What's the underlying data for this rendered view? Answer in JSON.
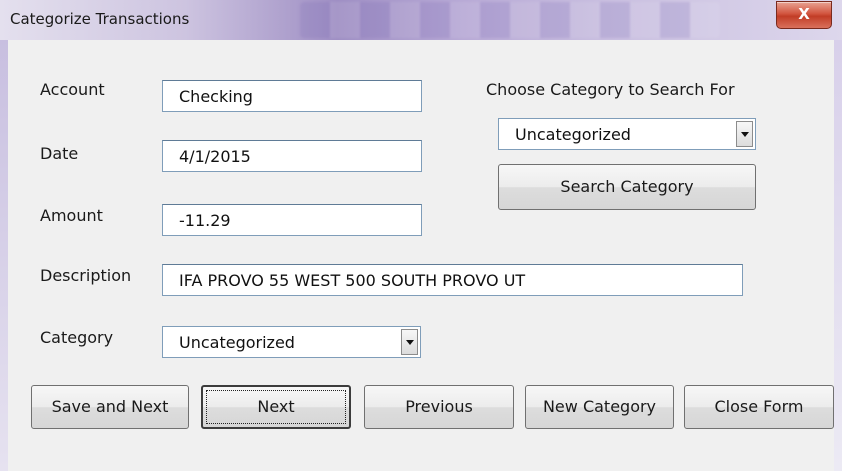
{
  "window": {
    "title": "Categorize Transactions",
    "close_glyph": "X"
  },
  "fields": {
    "account": {
      "label": "Account",
      "value": "Checking"
    },
    "date": {
      "label": "Date",
      "value": "4/1/2015"
    },
    "amount": {
      "label": "Amount",
      "value": "-11.29"
    },
    "description": {
      "label": "Description",
      "value": "IFA PROVO 55 WEST 500 SOUTH PROVO UT"
    },
    "category": {
      "label": "Category",
      "value": "Uncategorized"
    }
  },
  "search": {
    "label": "Choose Category to Search For",
    "selected": "Uncategorized",
    "button_label": "Search Category"
  },
  "buttons": {
    "save_next": "Save and Next",
    "next": "Next",
    "previous": "Previous",
    "new_category": "New Category",
    "close_form": "Close Form"
  },
  "colors": {
    "close_button": "#c13d26",
    "titlebar_accent": "#9f8fc4"
  }
}
